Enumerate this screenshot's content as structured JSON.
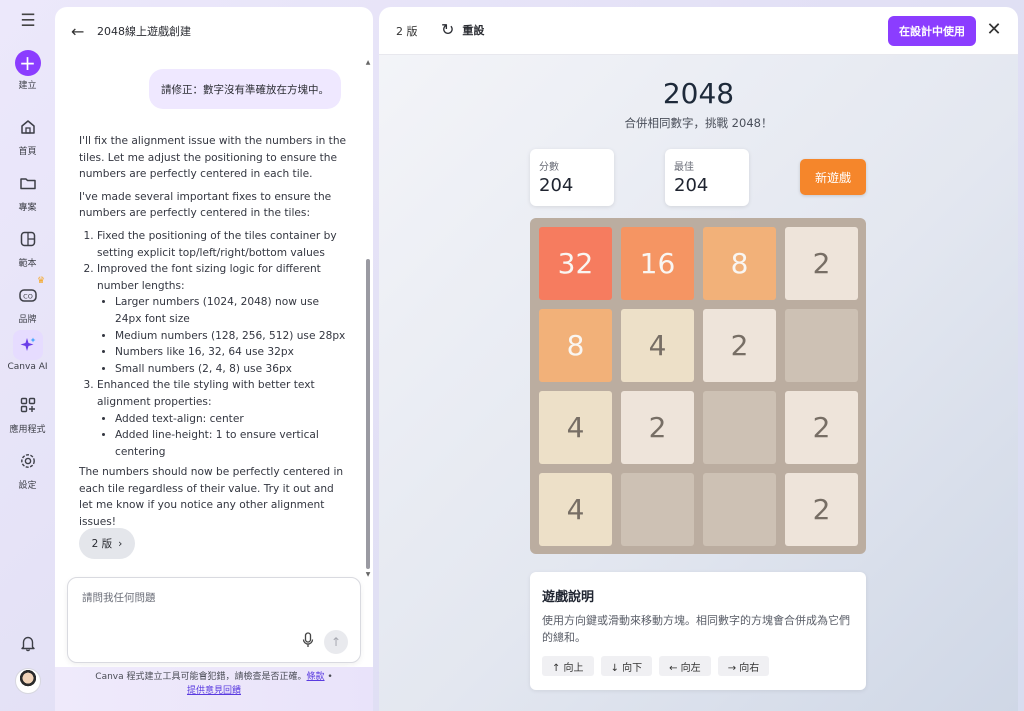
{
  "rail": {
    "items": [
      {
        "label": "建立"
      },
      {
        "label": "首頁"
      },
      {
        "label": "專案"
      },
      {
        "label": "範本"
      },
      {
        "label": "品牌"
      },
      {
        "label": "Canva AI"
      },
      {
        "label": "應用程式"
      },
      {
        "label": "設定"
      }
    ]
  },
  "chat": {
    "title": "2048線上遊戲創建",
    "user_message": "請修正：數字沒有準確放在方塊中。",
    "reply_intro": "I'll fix the alignment issue with the numbers in the tiles. Let me adjust the positioning to ensure the numbers are perfectly centered in each tile.",
    "reply_fixes": "I've made several important fixes to ensure the numbers are perfectly centered in the tiles:",
    "fix1": "Fixed the positioning of the tiles container by setting explicit top/left/right/bottom values",
    "fix2": "Improved the font sizing logic for different number lengths:",
    "fix2_items": [
      "Larger numbers (1024, 2048) now use 24px font size",
      "Medium numbers (128, 256, 512) use 28px",
      "Numbers like 16, 32, 64 use 32px",
      "Small numbers (2, 4, 8) use 36px"
    ],
    "fix3": "Enhanced the tile styling with better text alignment properties:",
    "fix3_items": [
      "Added text-align: center",
      "Added line-height: 1 to ensure vertical centering"
    ],
    "reply_outro": "The numbers should now be perfectly centered in each tile regardless of their value. Try it out and let me know if you notice any other alignment issues!",
    "version_chip": "2 版",
    "input_placeholder": "請問我任何問題",
    "disclaimer_text": "Canva 程式建立工具可能會犯錯，請檢查是否正確。",
    "terms_link": "條款",
    "feedback_link": "提供意見回饋"
  },
  "preview": {
    "version": "2 版",
    "reset_label": "重設",
    "use_button": "在設計中使用"
  },
  "game": {
    "title": "2048",
    "subtitle": "合併相同數字，挑戰 2048！",
    "score_label": "分數",
    "score_value": "204",
    "best_label": "最佳",
    "best_value": "204",
    "new_game": "新遊戲",
    "board": [
      [
        32,
        16,
        8,
        2
      ],
      [
        8,
        4,
        2,
        null
      ],
      [
        4,
        2,
        null,
        2
      ],
      [
        4,
        null,
        null,
        2
      ]
    ],
    "tile_colors": {
      "empty": "#cdc1b4",
      "2": "#eee4da",
      "4": "#ede0c8",
      "8": "#f2b179",
      "16": "#f59563",
      "32": "#f67c5f"
    },
    "help_title": "遊戲說明",
    "help_text": "使用方向鍵或滑動來移動方塊。相同數字的方塊會合併成為它們的總和。",
    "keys": [
      "↑ 向上",
      "↓ 向下",
      "← 向左",
      "→ 向右"
    ]
  }
}
